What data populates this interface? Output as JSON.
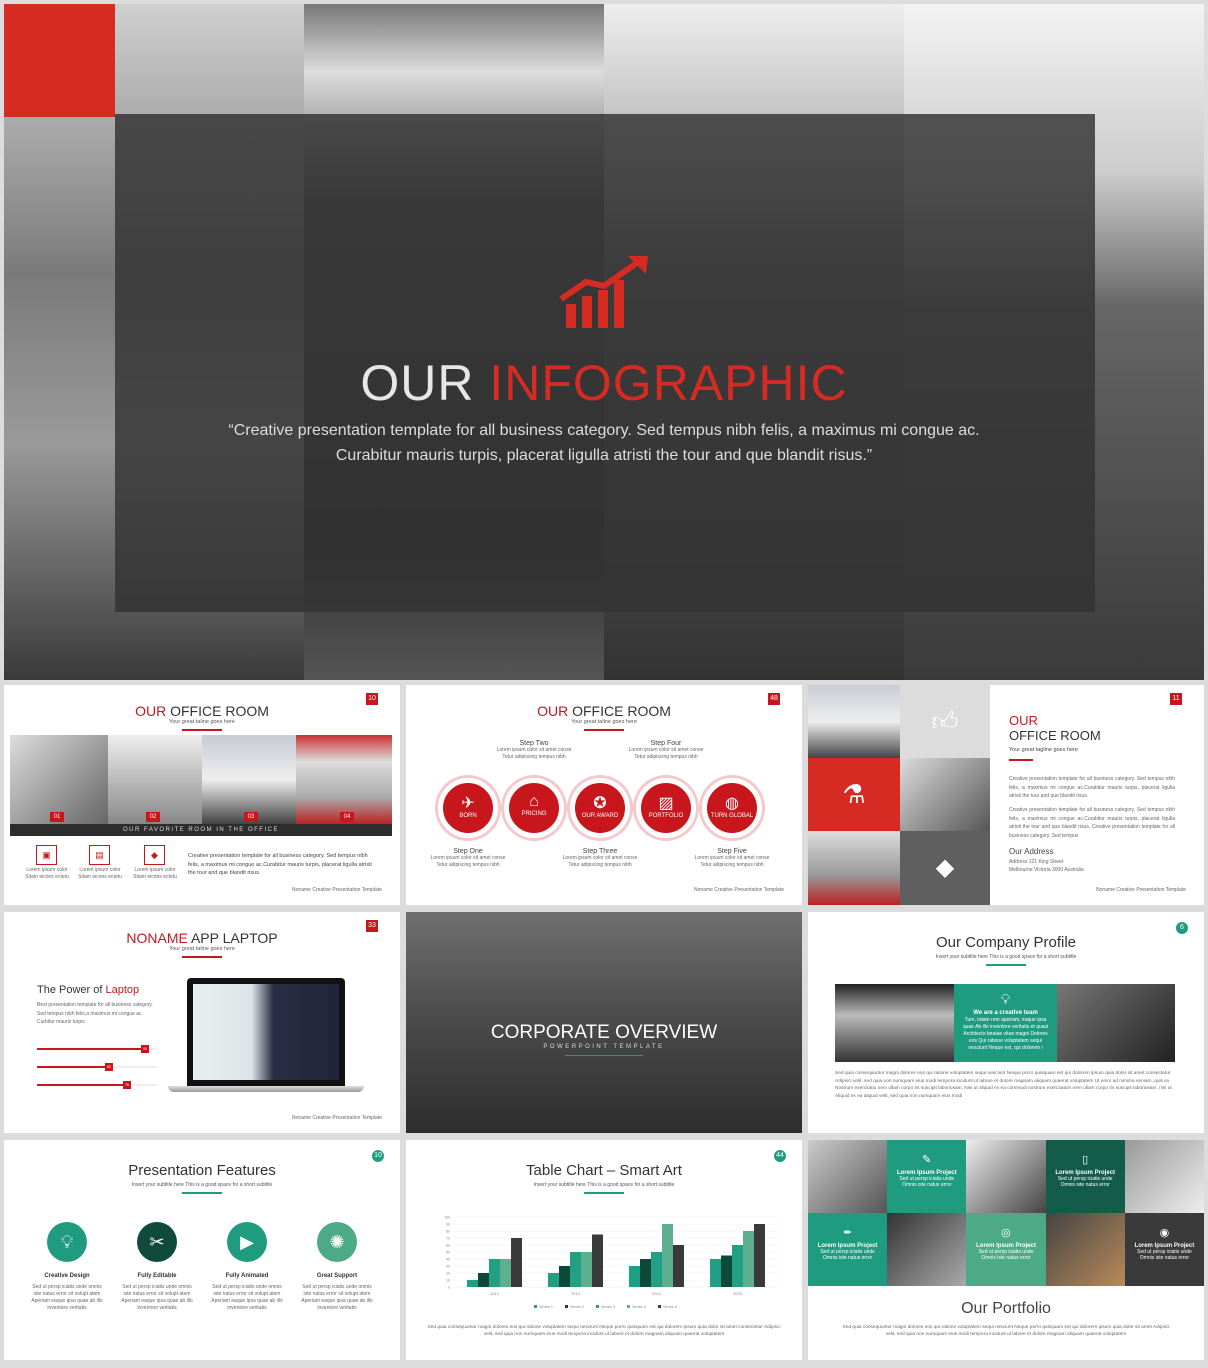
{
  "hero": {
    "title_a": "OUR",
    "title_b": "INFOGRAPHIC",
    "quote_1": "“Creative presentation template for all business category. Sed tempus nibh felis, a maximus mi congue ac.",
    "quote_2": "Curabitur mauris turpis, placerat ligulla atristi the tour and que blandit risus.”",
    "icon": "rising-chart-icon"
  },
  "s1": {
    "title_a": "OUR",
    "title_b": "OFFICE ROOM",
    "tagline": "Your great taline goes here",
    "num": "10",
    "rooms": [
      "01",
      "02",
      "03",
      "04"
    ],
    "banner": "OUR FAVORITE ROOM IN THE OFFICE",
    "icons": [
      {
        "l1": "Lorem ipsum color",
        "l2": "Sitam eicons ectetu"
      },
      {
        "l1": "Lorem ipsum color",
        "l2": "Sitam eicons ectetu"
      },
      {
        "l1": "Lorem ipsum color",
        "l2": "Sitam eicons ectetu"
      }
    ],
    "body": "Creative presentation template for all business category. Sed tempus nibh felis, a maximus mi congue ac.Curabitur mauris turpis, placerat ligulla atristi the tour and que blandit risus.",
    "footer": "Noname Creative Presentation Template"
  },
  "s2": {
    "title_a": "OUR",
    "title_b": "OFFICE ROOM",
    "tagline": "Your great taline goes here",
    "num": "48",
    "steps": [
      {
        "title": "Step One",
        "label": "BORN",
        "icon": "paper-plane"
      },
      {
        "title": "Step Two",
        "label": "PRICING",
        "icon": "tag"
      },
      {
        "title": "Step Three",
        "label": "OUR AWARD",
        "icon": "medal"
      },
      {
        "title": "Step Four",
        "label": "PORTFOLIO",
        "icon": "image"
      },
      {
        "title": "Step Five",
        "label": "TURN GLOBAL",
        "icon": "globe"
      }
    ],
    "step_l1": "Lorem ipsum color sit amet conse",
    "step_l2": "Tetur adipiscing tempus nibh",
    "footer": "Noname Creative Presentation Template"
  },
  "s3": {
    "title_a": "OUR",
    "title_b": "OFFICE ROOM",
    "tagline": "Your great tagline goes here",
    "num": "11",
    "p1": "Creative presentation template for all business category. Sed tempus nibh felis, a maximus mi congue ac.Curabitur mauris turpis, placerat ligulla atristi the tour and que blandit risus.",
    "p2": "Creative presentation template for all business category. Sed tempus nibh felis, a maximus mi congue ac.Curabitur mauris turpis, placerat ligulla atristi the tour and que blandit risus. Creative presentation template for all business category. Sed tempus",
    "addr_title": "Our Address",
    "addr_1": "Address 121 King Street",
    "addr_2": "Melbourne Victoria 3000 Australia",
    "footer": "Noname Creative Presentation Template"
  },
  "s4": {
    "title_a": "NONAME",
    "title_b": "APP LAPTOP",
    "tagline": "Your great taline goes here",
    "num": "33",
    "h_a": "The Power of",
    "h_b": "Laptop",
    "body": "Best presentation template for all business category. Sed tempus nibh felis,a maximus mi congue ac. Curbitur mauris turpis",
    "sliders": [
      {
        "value": 90,
        "label": "90"
      },
      {
        "value": 60,
        "label": "60"
      },
      {
        "value": 75,
        "label": "75"
      }
    ],
    "footer": "Noname Creative Presentation Template"
  },
  "s5": {
    "title": "CORPORATE OVERVIEW",
    "subtitle": "POWERPOINT TEMPLATE"
  },
  "s6": {
    "title": "Our Company Profile",
    "subtitle": "Insert your subtitle here This is a good space for a short subtitle",
    "num": "6",
    "box_title": "We are a creative team",
    "box_body": "Tum, totam rem aperiam, eaque ipsa quae Ab illo inventore veritatis et quasi Architecto beatae vitae magni Dolores eos Qui ratione voluptatem sequi nesciunt Neque est, qui dolorem i",
    "body": "Sed quia consequuntur magni dolores eos qui ratione voluptatem sequi nesciunt Neque porro quisquam est qui dolorem ipsum quia dolor sit amet consectetur Adipisci velit, sed quia non numquam eius modi tempora incidunt ut labore et dolore magnam aliquam quaerat voluptatem Ut enim ad minima veniam, quis ex Nostrum exercitatio nem ullam corpo ris suscipit laboriosam. Nisi ut aliquid ex ea commodi nostrum exercitation nem ullam corpo ris suscipit laboriosam. nisi ut Aliquid ex ea aliquid velit, sed quia non numquam eius modi"
  },
  "s7": {
    "title": "Presentation Features",
    "subtitle": "Insert your subtitle here This is a good space for a short subtitle",
    "num": "10",
    "features": [
      {
        "title": "Creative Design",
        "icon": "lightbulb",
        "color": "#1f9c80"
      },
      {
        "title": "Fully Editable",
        "icon": "tools",
        "color": "#0f4a3b"
      },
      {
        "title": "Fully Animated",
        "icon": "film",
        "color": "#1f9c80"
      },
      {
        "title": "Great Support",
        "icon": "lifebuoy",
        "color": "#4daa86"
      }
    ],
    "feature_body": "Sed ut persp iciatis unde omnis iste natus error sit volupt atem Aperiam eaque ipsa quae ab illo inventore veritatis"
  },
  "s8": {
    "title": "Table Chart – Smart Art",
    "subtitle": "Insert your subtitle here This is a good space for a short subtitle",
    "num": "44",
    "body": "Sed quia consequuntur magni dolores eos qui ratione voluptatem sequi nesciunt Neque porro quisquam est qui dolorem ipsum quia dolor sit amet consectetur Adipisci velit, sed quia non numquam eius modi tempora incidunt ut labore et dolore magnam aliquam quaerat voluptatem"
  },
  "s9": {
    "title": "Our Portfolio",
    "tile_title": "Lorem Ipsum Project",
    "tile_l1": "Sed ut persp iciatis unde",
    "tile_l2": "Omnis iste natus error",
    "body": "Sed quia consequuntur magni dolores eos qui ratione voluptatem sequi nesciunt Neque porro quisquam est qui dolorem ipsum quia dolor sit amet Adipisci velit, sed quia non numquam eius modi tempora incidunt ut labore et dolore magnam aliquam quaerat voluptatem"
  },
  "chart_data": {
    "type": "bar",
    "title": "Table Chart – Smart Art",
    "categories": [
      "2012",
      "2013",
      "2014",
      "2015"
    ],
    "ylim": [
      0,
      100
    ],
    "yticks": [
      0,
      10,
      20,
      30,
      40,
      50,
      60,
      70,
      80,
      90,
      100
    ],
    "legend": "bottom",
    "grid": true,
    "series": [
      {
        "name": "Series 1",
        "color": "#1fa084",
        "values": [
          10,
          20,
          30,
          40
        ]
      },
      {
        "name": "Series 2",
        "color": "#0b4a38",
        "values": [
          20,
          30,
          40,
          45
        ]
      },
      {
        "name": "Series 3",
        "color": "#22a083",
        "values": [
          40,
          50,
          50,
          60
        ]
      },
      {
        "name": "Series 4",
        "color": "#5cb08f",
        "values": [
          40,
          50,
          90,
          80
        ]
      },
      {
        "name": "Series 5",
        "color": "#3a3a3a",
        "values": [
          70,
          75,
          60,
          90
        ]
      }
    ]
  }
}
